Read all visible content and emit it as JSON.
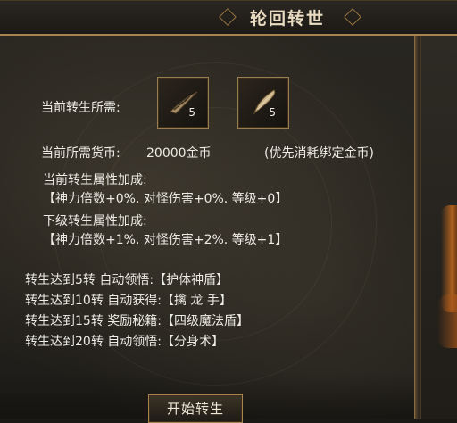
{
  "window": {
    "title": "轮回转世"
  },
  "requirements": {
    "label": "当前转生所需:",
    "items": [
      {
        "icon": "bone-claw-icon",
        "count": "5"
      },
      {
        "icon": "fang-icon",
        "count": "5"
      }
    ]
  },
  "currency": {
    "label": "当前所需货币:",
    "amount": "20000金币",
    "note": "(优先消耗绑定金币)"
  },
  "current_bonus": {
    "label": "当前转生属性加成:",
    "value": "【神力倍数+0%. 对怪伤害+0%. 等级+0】"
  },
  "next_bonus": {
    "label": "下级转生属性加成:",
    "value": "【神力倍数+1%. 对怪伤害+2%. 等级+1】"
  },
  "rewards": [
    "转生达到5转  自动领悟:【护体神盾】",
    "转生达到10转  自动获得:【擒 龙 手】",
    "转生达到15转  奖励秘籍:【四级魔法盾】",
    "转生达到20转  自动领悟:【分身术】"
  ],
  "actions": {
    "start_label": "开始转生"
  },
  "colors": {
    "frame_gold": "#a9824c",
    "text": "#ecebe4",
    "accent_orange": "#c46b1f"
  }
}
